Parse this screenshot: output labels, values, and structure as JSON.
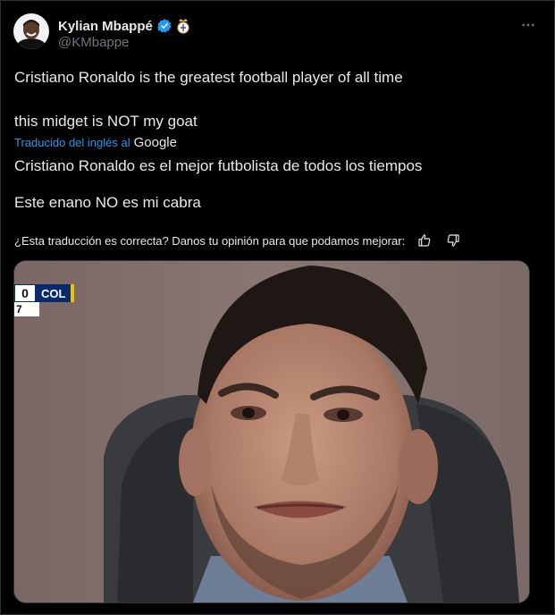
{
  "author": {
    "display_name": "Kylian Mbappé",
    "handle": "@KMbappe",
    "verified_icon": "verified-badge-icon",
    "affiliation_icon": "real-madrid-crest-icon"
  },
  "post": {
    "line1": "Cristiano Ronaldo is the greatest football player of all time",
    "line2": "this midget is NOT my goat"
  },
  "translation": {
    "translated_by_label": "Traducido del inglés al",
    "provider": "Google",
    "line1": "Cristiano Ronaldo es el mejor futbolista de todos los tiempos",
    "line2": "Este enano NO es mi cabra",
    "feedback_prompt": "¿Esta traducción es correcta? Danos tu opinión para que podamos mejorar:"
  },
  "media": {
    "scorebug": {
      "score": "0",
      "team": "COL",
      "sub": "7"
    }
  },
  "colors": {
    "background": "#000000",
    "text": "#e7e9ea",
    "secondary": "#71767b",
    "link": "#1d9bf0",
    "verified": "#1d9bf0",
    "border": "#2f3336"
  }
}
